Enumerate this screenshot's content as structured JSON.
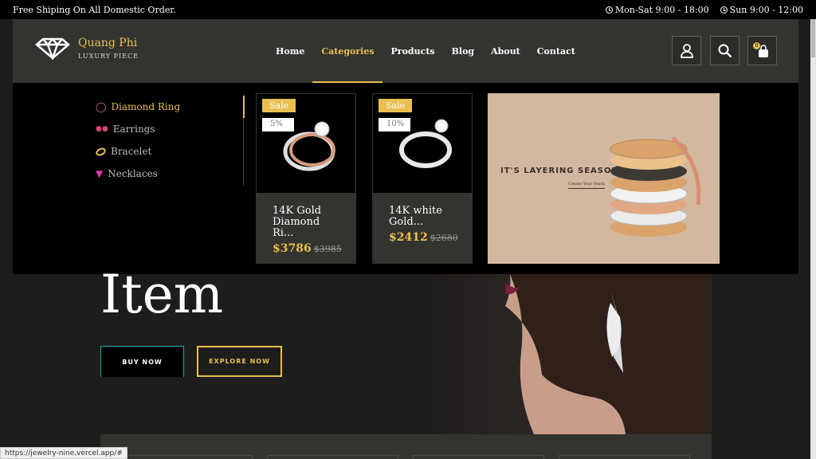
{
  "topbar": {
    "shipping_text": "Free Shiping On All Domestic Order.",
    "hours_weekday": "Mon-Sat 9:00 - 18:00",
    "hours_sunday": "Sun 9:00 - 12:00"
  },
  "brand": {
    "name": "Quang Phi",
    "tagline": "LUXURY PIECE"
  },
  "nav": {
    "home": "Home",
    "categories": "Categories",
    "products": "Products",
    "blog": "Blog",
    "about": "About",
    "contact": "Contact"
  },
  "cart": {
    "count": "0"
  },
  "categories": [
    {
      "label": "Diamond Ring",
      "icon": "ring-icon",
      "active": true
    },
    {
      "label": "Earrings",
      "icon": "earrings-icon",
      "active": false
    },
    {
      "label": "Bracelet",
      "icon": "bracelet-icon",
      "active": false
    },
    {
      "label": "Necklaces",
      "icon": "necklace-icon",
      "active": false
    }
  ],
  "products": [
    {
      "badge": "Sale",
      "discount": "5%",
      "name_line1": "14K Gold",
      "name_line2": "Diamond Ri...",
      "price": "$3786",
      "old_price": "$3985"
    },
    {
      "badge": "Sale",
      "discount": "10%",
      "name_line1": "14K white",
      "name_line2": "Gold...",
      "price": "$2412",
      "old_price": "$2680"
    }
  ],
  "banner": {
    "title": "IT'S LAYERING SEASON",
    "link": "Create Your Stack"
  },
  "hero": {
    "title": "Item",
    "buy_now": "BUY NOW",
    "explore_now": "EXPLORE NOW"
  },
  "status_url": "https://jewelry-nine.vercel.app/#",
  "colors": {
    "accent": "#e9c04f",
    "header_bg": "#333330",
    "page_bg": "#1d1d1b"
  }
}
